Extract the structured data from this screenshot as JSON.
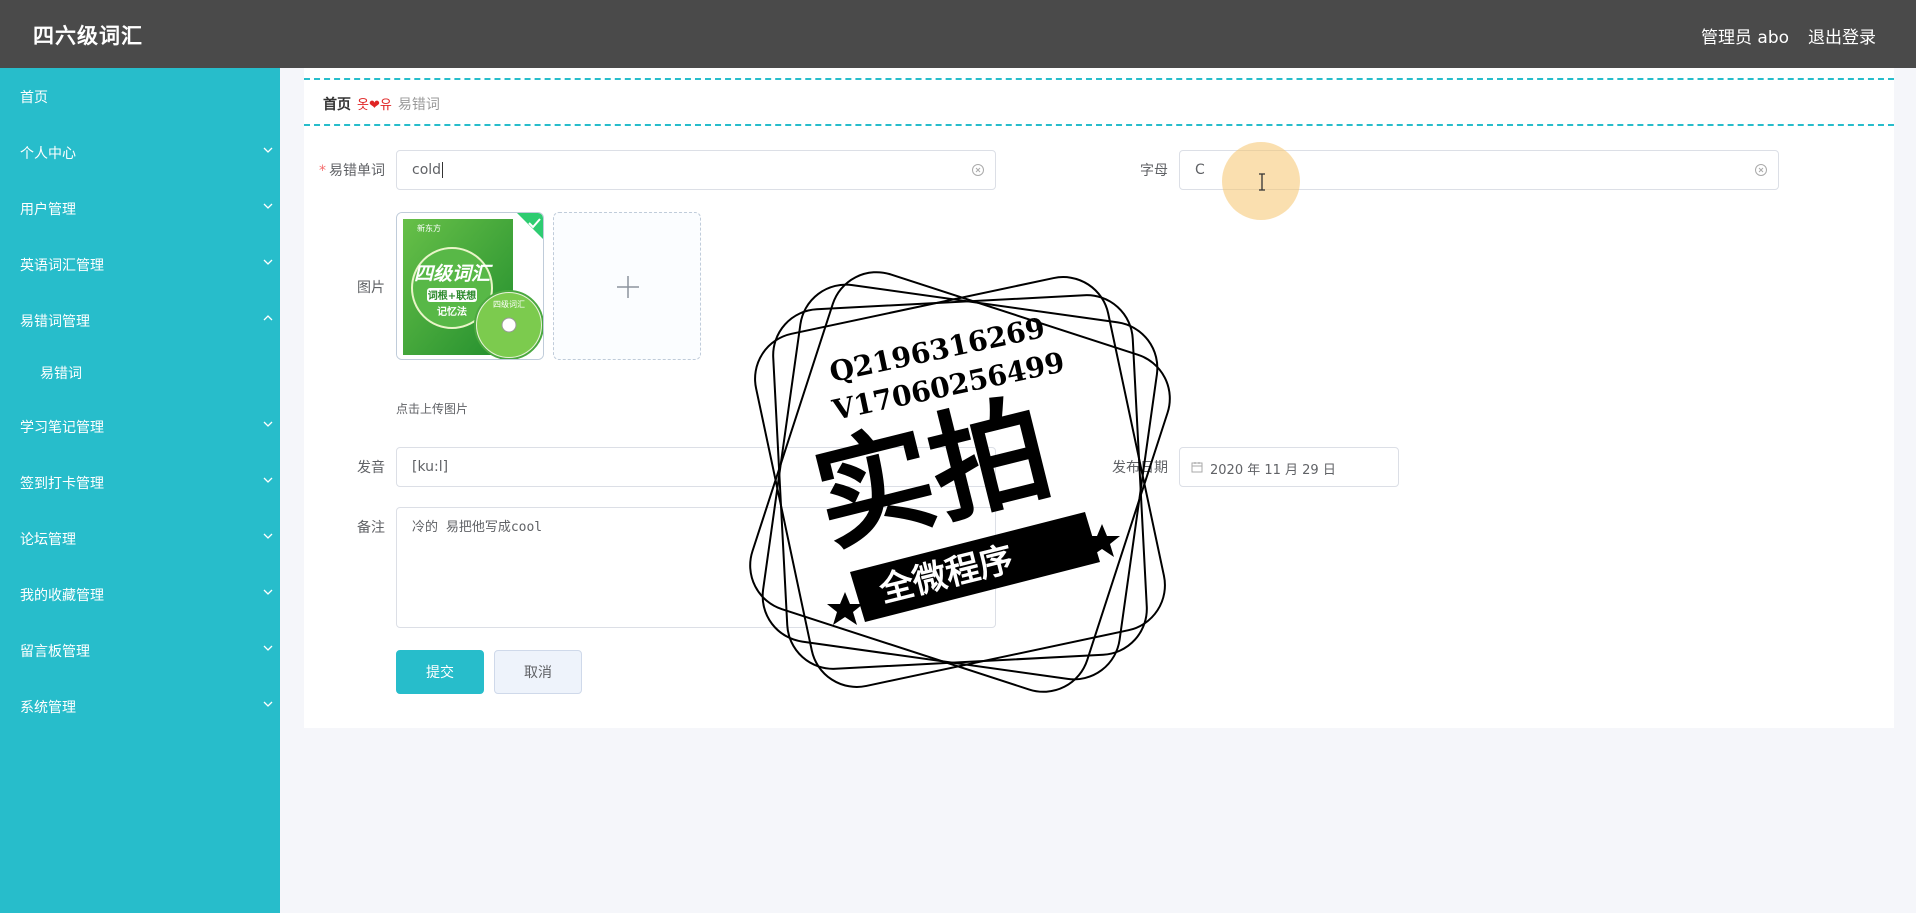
{
  "header": {
    "brand": "四六级词汇",
    "admin": "管理员 abo",
    "logout": "退出登录"
  },
  "sidebar": {
    "items": [
      {
        "label": "首页",
        "chevron": ""
      },
      {
        "label": "个人中心",
        "chevron": "down"
      },
      {
        "label": "用户管理",
        "chevron": "down"
      },
      {
        "label": "英语词汇管理",
        "chevron": "down"
      },
      {
        "label": "易错词管理",
        "chevron": "up"
      },
      {
        "label": "易错词",
        "chevron": ""
      },
      {
        "label": "学习笔记管理",
        "chevron": "down"
      },
      {
        "label": "签到打卡管理",
        "chevron": "down"
      },
      {
        "label": "论坛管理",
        "chevron": "down"
      },
      {
        "label": "我的收藏管理",
        "chevron": "down"
      },
      {
        "label": "留言板管理",
        "chevron": "down"
      },
      {
        "label": "系统管理",
        "chevron": "down"
      }
    ]
  },
  "breadcrumb": {
    "home": "首页",
    "separator": "옷❤유",
    "current": "易错词"
  },
  "form": {
    "word_label": "易错单词",
    "word_value": "cold",
    "letter_label": "字母",
    "letter_value": "C",
    "image_label": "图片",
    "image_hint": "点击上传图片",
    "book": {
      "title": "四级词汇",
      "subtitle": "词根+联想",
      "subtitle2": "记忆法",
      "disc": "四级词汇",
      "publisher": "新东方"
    },
    "pron_label": "发音",
    "pron_value": "[ku:l]",
    "date_label": "发布日期",
    "date_value": "2020 年 11 月 29 日",
    "note_label": "备注",
    "note_value": "冷的 易把他写成cool",
    "submit": "提交",
    "cancel": "取消"
  },
  "watermark": {
    "line1": "Q2196316269",
    "line2": "V17060256499",
    "main": "实拍",
    "ribbon": "全微程序"
  },
  "colors": {
    "accent": "#27bdcb",
    "header": "#4a4a4a",
    "danger": "#f56c6c"
  },
  "icons": {
    "clear": "circle-x-icon",
    "plus": "plus-icon",
    "calendar": "calendar-icon",
    "check": "check-icon"
  }
}
